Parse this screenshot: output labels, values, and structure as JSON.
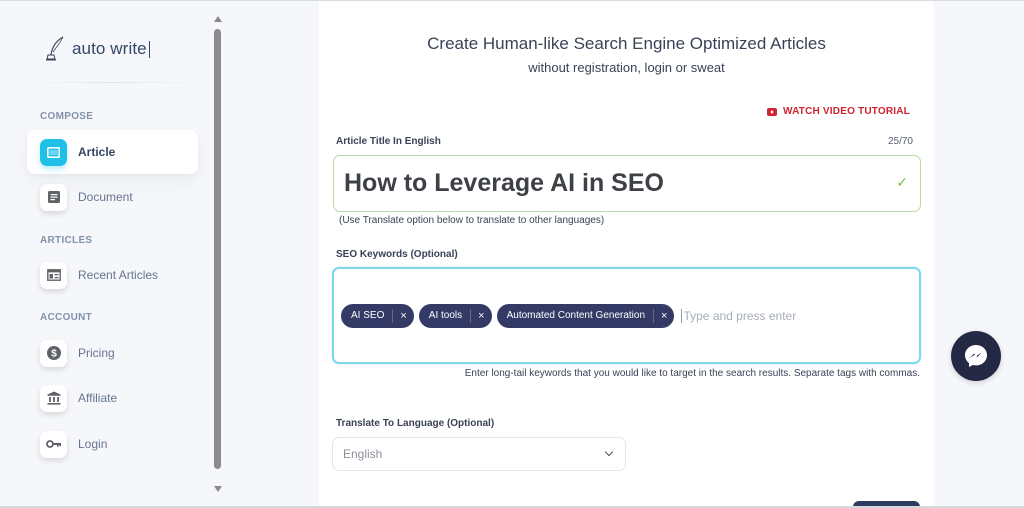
{
  "brand": {
    "name": "auto write",
    "icon": "quill-pen-icon"
  },
  "sidebar": {
    "sections": [
      {
        "label": "COMPOSE",
        "items": [
          {
            "label": "Article",
            "icon": "article-icon",
            "active": true
          },
          {
            "label": "Document",
            "icon": "document-icon",
            "active": false
          }
        ]
      },
      {
        "label": "ARTICLES",
        "items": [
          {
            "label": "Recent Articles",
            "icon": "recent-articles-icon",
            "active": false
          }
        ]
      },
      {
        "label": "ACCOUNT",
        "items": [
          {
            "label": "Pricing",
            "icon": "dollar-icon",
            "active": false
          },
          {
            "label": "Affiliate",
            "icon": "bank-icon",
            "active": false
          },
          {
            "label": "Login",
            "icon": "key-icon",
            "active": false
          }
        ]
      }
    ]
  },
  "main": {
    "headline": "Create Human-like Search Engine Optimized Articles",
    "subheadline": "without registration, login or sweat",
    "video_link": "WATCH VIDEO TUTORIAL",
    "title_field": {
      "label": "Article Title In English",
      "counter": "25/70",
      "value": "How to Leverage AI in SEO",
      "valid": true,
      "hint": "(Use Translate option below to translate to other languages)"
    },
    "keywords_field": {
      "label": "SEO Keywords (Optional)",
      "tags": [
        "AI SEO",
        "AI tools",
        "Automated Content Generation"
      ],
      "remove_glyph": "×",
      "placeholder": "Type and press enter",
      "help": "Enter long-tail keywords that you would like to target in the search results. Separate tags with commas."
    },
    "language_field": {
      "label": "Translate To Language (Optional)",
      "selected": "English"
    }
  },
  "colors": {
    "accent": "#1fc0e8",
    "tag_bg": "#333a66",
    "video_red": "#d12330",
    "valid_green": "#7ac143",
    "messenger_bg": "#232845"
  }
}
